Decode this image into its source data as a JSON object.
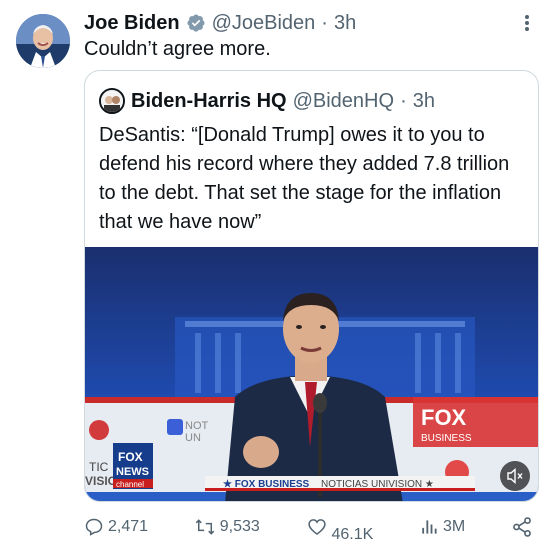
{
  "tweet": {
    "author_name": "Joe Biden",
    "author_handle": "@JoeBiden",
    "separator": "·",
    "time": "3h",
    "text": "Couldn’t agree more."
  },
  "quoted_tweet": {
    "author_name": "Biden-Harris HQ",
    "author_handle": "@BidenHQ",
    "separator": "·",
    "time": "3h",
    "text": "DeSantis: “[Donald Trump] owes it to you to defend his record where they added 7.8 trillion to the debt. That set the stage for the inflation that we have now”"
  },
  "media": {
    "left_logo_line1": "FOX",
    "left_logo_line2": "NEWS",
    "left_logo_line3": "channel",
    "right_logo_line1": "FOX",
    "right_logo_line2": "BUSINESS",
    "left_podium_partial": "NOT",
    "left_podium_partial2": "UN",
    "left_edge_text": "TIC",
    "left_edge_text2": "VISION",
    "ticker_left": "★ FOX BUSINESS",
    "ticker_right": "NOTICIAS UNIVISION ★",
    "mic_star": "★"
  },
  "actions": {
    "replies": "2,471",
    "reposts": "9,533",
    "likes": "46.1K",
    "views": "3M"
  },
  "colors": {
    "verified": "#1d9bf0",
    "text_primary": "#0f1419",
    "text_secondary": "#536471",
    "stage_blue": "#1c3f9a",
    "border": "#cfd9de"
  },
  "icons": [
    "verified-badge-icon",
    "more-icon",
    "reply-icon",
    "repost-icon",
    "like-icon",
    "views-icon",
    "share-icon",
    "mute-icon"
  ]
}
